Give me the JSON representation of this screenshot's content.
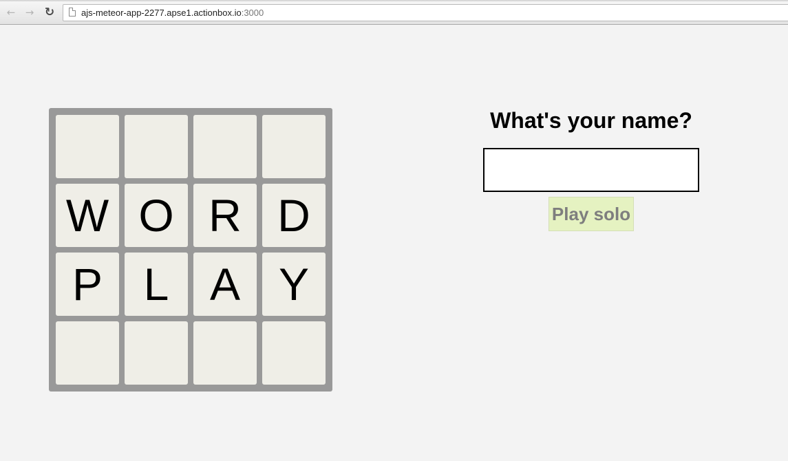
{
  "browser": {
    "back_icon": "arrow-left-icon",
    "forward_icon": "arrow-right-icon",
    "reload_icon": "reload-icon",
    "url_host": "ajs-meteor-app-2277.apse1.actionbox.io",
    "url_port": ":3000"
  },
  "board": {
    "tiles": [
      "",
      "",
      "",
      "",
      "W",
      "O",
      "R",
      "D",
      "P",
      "L",
      "A",
      "Y",
      "",
      "",
      "",
      ""
    ]
  },
  "login": {
    "heading": "What's your name?",
    "name_value": "",
    "play_button_label": "Play solo"
  },
  "colors": {
    "board_frame": "#999999",
    "tile": "#efeee7",
    "play_button_bg": "#e5f2c1",
    "page_bg": "#f3f3f3"
  }
}
